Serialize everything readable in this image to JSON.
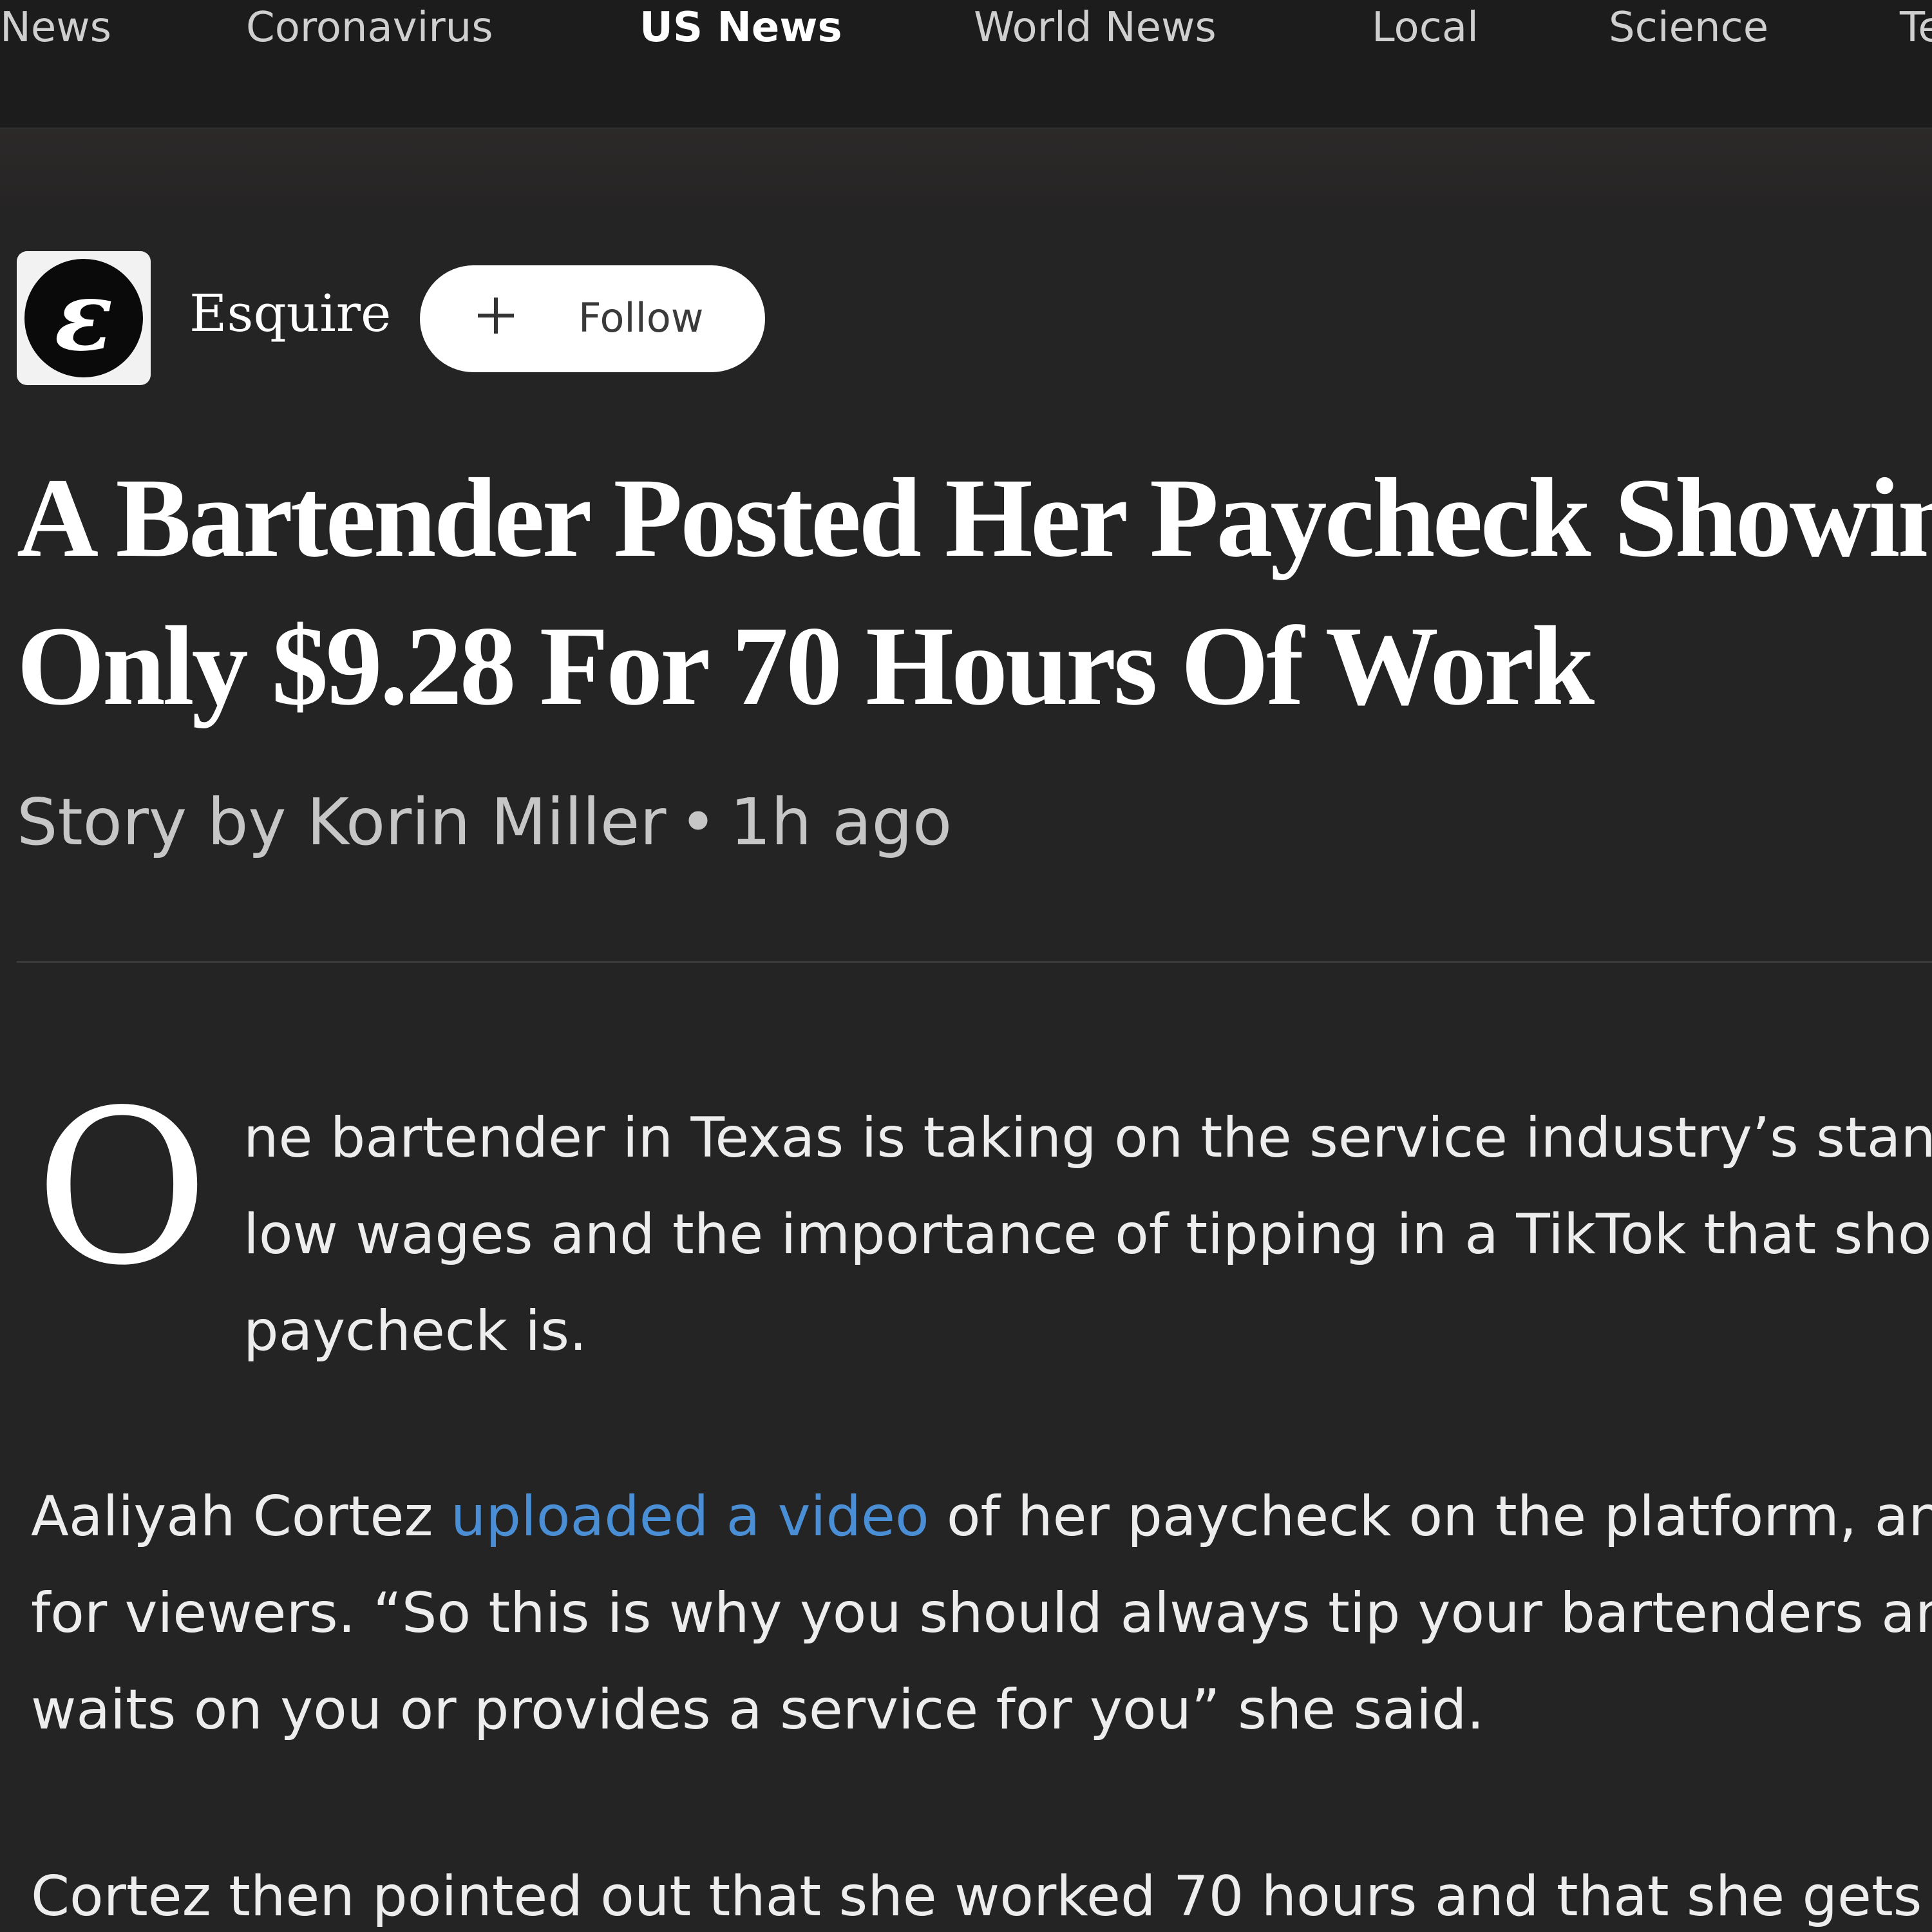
{
  "nav": {
    "items": [
      {
        "label": "News",
        "active": false
      },
      {
        "label": "Coronavirus",
        "active": false
      },
      {
        "label": "US News",
        "active": true
      },
      {
        "label": "World News",
        "active": false
      },
      {
        "label": "Local",
        "active": false
      },
      {
        "label": "Science",
        "active": false
      },
      {
        "label": "Te",
        "active": false
      }
    ]
  },
  "source": {
    "logo_letter": "ε",
    "name": "Esquire",
    "follow_label": "Follow",
    "follow_icon": "plus-icon"
  },
  "article": {
    "headline_line1": "A Bartender Posted Her Paycheck Showing",
    "headline_line2": "Only $9.28 For 70 Hours Of Work",
    "byline": {
      "author": "Story by Korin Miller",
      "separator": "•",
      "time": "1h ago"
    },
    "drop_cap": "O",
    "paragraph1": [
      "ne bartender in Texas is taking on the service industry’s stand",
      "low wages and the importance of tipping in a TikTok that sho",
      "paycheck is."
    ],
    "paragraph2": {
      "line1_before": "Aaliyah Cortez ",
      "line1_link": "uploaded a video",
      "line1_after": " of her paycheck on the platform, an",
      "line2": "for viewers. “So this is why you should always tip your bartenders and",
      "line3": "waits on you or provides a service for you” she said."
    },
    "paragraph3": [
      "Cortez then pointed out that she worked 70 hours and that she gets"
    ]
  },
  "colors": {
    "background": "#242424",
    "nav_background": "#1c1c1c",
    "link": "#4a8fd6",
    "follow_button": "#ffffff"
  }
}
